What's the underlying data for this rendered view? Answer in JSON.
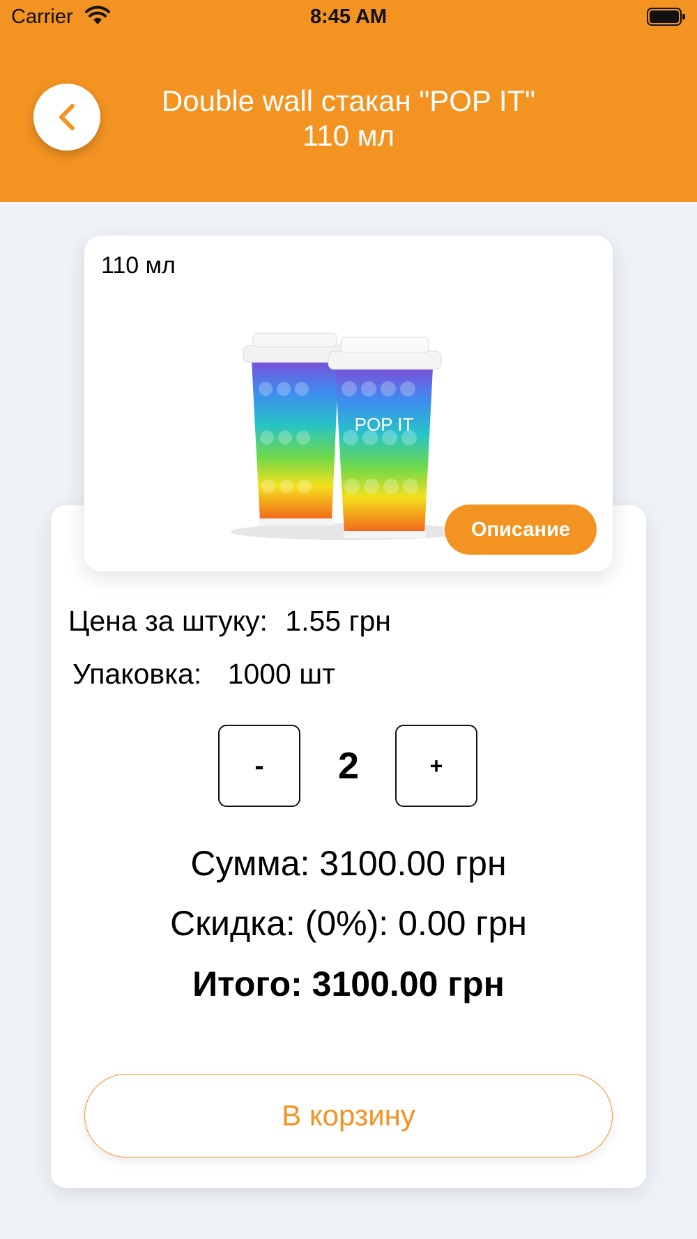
{
  "status_bar": {
    "carrier": "Carrier",
    "time": "8:45 AM"
  },
  "header": {
    "title_line1": "Double wall стакан \"POP IT\"",
    "title_line2": "110 мл",
    "back_icon": "chevron-left-icon"
  },
  "product": {
    "volume_label": "110 мл",
    "image_text": "POP IT",
    "description_button": "Описание"
  },
  "pricing": {
    "price_label": "Цена за штуку:",
    "price_value": "1.55 грн",
    "package_label": "Упаковка:",
    "package_value": "1000 шт"
  },
  "quantity": {
    "minus": "-",
    "value": "2",
    "plus": "+"
  },
  "totals": {
    "sum": "Сумма: 3100.00 грн",
    "discount": "Скидка: (0%): 0.00 грн",
    "total": "Итого: 3100.00 грн"
  },
  "cart_button": "В корзину",
  "colors": {
    "accent": "#f39322",
    "background": "#eff2f7"
  }
}
